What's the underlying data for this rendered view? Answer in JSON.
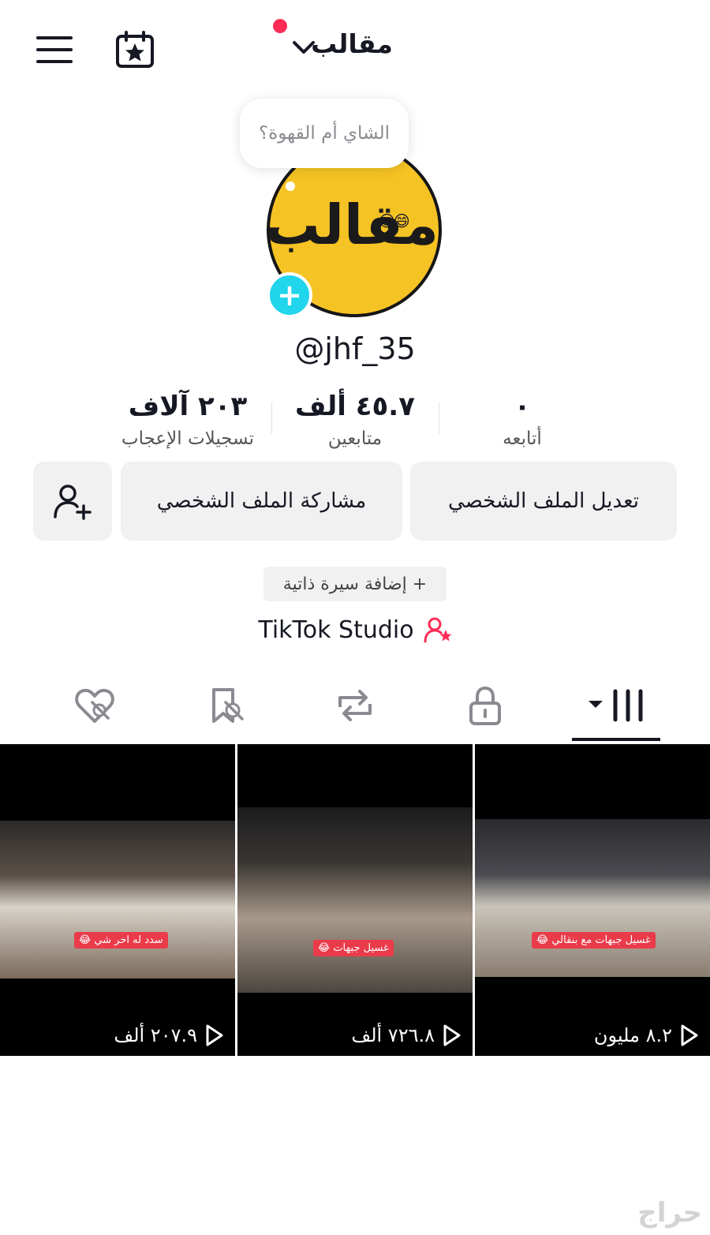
{
  "header": {
    "title": "مقالب",
    "has_notification_dot": true
  },
  "profile": {
    "bubble_note": "الشاي أم القهوة؟",
    "avatar_text": "مقالب",
    "username": "@jhf_35"
  },
  "stats": [
    {
      "value": "٠",
      "label": "أتابعه"
    },
    {
      "value": "٤٥.٧ ألف",
      "label": "متابعين"
    },
    {
      "value": "٢٠٣ آلاف",
      "label": "تسجيلات الإعجاب"
    }
  ],
  "actions": {
    "edit_profile": "تعديل الملف الشخصي",
    "share_profile": "مشاركة الملف الشخصي",
    "add_bio": "+ إضافة سيرة ذاتية",
    "studio": "TikTok Studio"
  },
  "tabs": [
    {
      "icon": "grid-icon",
      "active": true
    },
    {
      "icon": "lock-icon",
      "active": false
    },
    {
      "icon": "repost-icon",
      "active": false
    },
    {
      "icon": "bookmark-hidden-icon",
      "active": false
    },
    {
      "icon": "heart-hidden-icon",
      "active": false
    }
  ],
  "videos": [
    {
      "caption": "غسيل جبهات مع بنقالي 😂",
      "views": "٨.٢ مليون"
    },
    {
      "caption": "غسيل جبهات 😂",
      "views": "٧٢٦.٨ ألف"
    },
    {
      "caption": "سدد له اخر شي 😂",
      "views": "٢٠٧.٩ ألف"
    }
  ],
  "watermark": "حراج",
  "colors": {
    "accent": "#fe2c55",
    "plus": "#20d5ec",
    "avatar_bg": "#f6c324",
    "button_bg": "#f1f1f2"
  }
}
